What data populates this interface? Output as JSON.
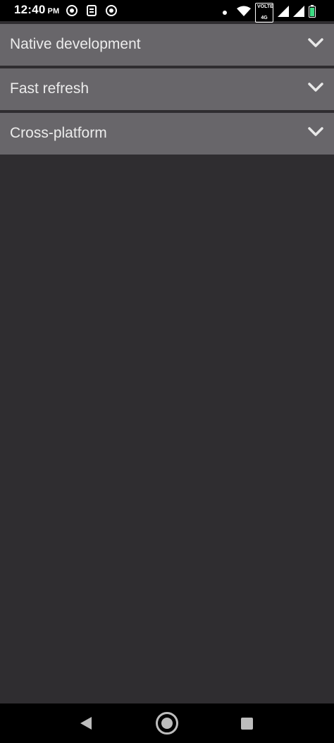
{
  "status_bar": {
    "time": "12:40",
    "ampm": "PM",
    "left_icons": [
      "screen-record-icon",
      "sim-toolkit-icon",
      "screen-record-icon"
    ],
    "right_icons": [
      "notification-dot-icon",
      "wifi-icon",
      "volte-badge",
      "signal-icon",
      "signal-icon",
      "battery-icon"
    ],
    "volte_label": "VOLTE",
    "volte_sub": "4G"
  },
  "accordion": {
    "items": [
      {
        "title": "Native development",
        "icon": "chevron-down-icon",
        "expanded": false
      },
      {
        "title": "Fast refresh",
        "icon": "chevron-down-icon",
        "expanded": false
      },
      {
        "title": "Cross-platform",
        "icon": "chevron-down-icon",
        "expanded": false
      }
    ]
  },
  "nav_bar": {
    "buttons": [
      "back-icon",
      "home-icon",
      "recents-icon"
    ]
  },
  "colors": {
    "background": "#2f2d30",
    "accordion_header": "#68666a",
    "accordion_text": "#ececec",
    "bars": "#000000"
  }
}
